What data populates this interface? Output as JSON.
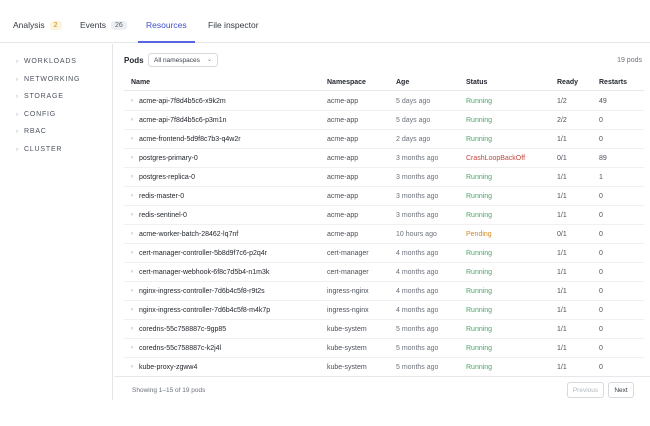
{
  "tabs": [
    {
      "label": "Analysis",
      "badge": "2"
    },
    {
      "label": "Events",
      "badge": "26"
    },
    {
      "label": "Resources",
      "badge": ""
    },
    {
      "label": "File inspector",
      "badge": ""
    }
  ],
  "active_tab": "Resources",
  "sidebar": {
    "items": [
      {
        "label": "WORKLOADS"
      },
      {
        "label": "NETWORKING"
      },
      {
        "label": "STORAGE"
      },
      {
        "label": "CONFIG"
      },
      {
        "label": "RBAC"
      },
      {
        "label": "CLUSTER"
      }
    ]
  },
  "pods": {
    "title": "Pods",
    "namespace_filter": "All namespaces",
    "count_label": "19 pods",
    "columns": {
      "name": "Name",
      "namespace": "Namespace",
      "age": "Age",
      "status": "Status",
      "ready": "Ready",
      "restarts": "Restarts"
    },
    "rows": [
      {
        "name": "acme-api-7f8d4b5c6-x9k2m",
        "namespace": "acme-app",
        "age": "5 days ago",
        "status": "Running",
        "ready": "1/2",
        "restarts": "49"
      },
      {
        "name": "acme-api-7f8d4b5c6-p3m1n",
        "namespace": "acme-app",
        "age": "5 days ago",
        "status": "Running",
        "ready": "2/2",
        "restarts": "0"
      },
      {
        "name": "acme-frontend-5d9f8c7b3-q4w2r",
        "namespace": "acme-app",
        "age": "2 days ago",
        "status": "Running",
        "ready": "1/1",
        "restarts": "0"
      },
      {
        "name": "postgres-primary-0",
        "namespace": "acme-app",
        "age": "3 months ago",
        "status": "CrashLoopBackOff",
        "ready": "0/1",
        "restarts": "89"
      },
      {
        "name": "postgres-replica-0",
        "namespace": "acme-app",
        "age": "3 months ago",
        "status": "Running",
        "ready": "1/1",
        "restarts": "1"
      },
      {
        "name": "redis-master-0",
        "namespace": "acme-app",
        "age": "3 months ago",
        "status": "Running",
        "ready": "1/1",
        "restarts": "0"
      },
      {
        "name": "redis-sentinel-0",
        "namespace": "acme-app",
        "age": "3 months ago",
        "status": "Running",
        "ready": "1/1",
        "restarts": "0"
      },
      {
        "name": "acme-worker-batch-28462-lq7nf",
        "namespace": "acme-app",
        "age": "10 hours ago",
        "status": "Pending",
        "ready": "0/1",
        "restarts": "0"
      },
      {
        "name": "cert-manager-controller-5b8d9f7c6-p2q4r",
        "namespace": "cert-manager",
        "age": "4 months ago",
        "status": "Running",
        "ready": "1/1",
        "restarts": "0"
      },
      {
        "name": "cert-manager-webhook-6f8c7d5b4-n1m3k",
        "namespace": "cert-manager",
        "age": "4 months ago",
        "status": "Running",
        "ready": "1/1",
        "restarts": "0"
      },
      {
        "name": "nginx-ingress-controller-7d6b4c5f8-r9t2s",
        "namespace": "ingress-nginx",
        "age": "4 months ago",
        "status": "Running",
        "ready": "1/1",
        "restarts": "0"
      },
      {
        "name": "nginx-ingress-controller-7d6b4c5f8-m4k7p",
        "namespace": "ingress-nginx",
        "age": "4 months ago",
        "status": "Running",
        "ready": "1/1",
        "restarts": "0"
      },
      {
        "name": "coredns-55c758887c-9gp85",
        "namespace": "kube-system",
        "age": "5 months ago",
        "status": "Running",
        "ready": "1/1",
        "restarts": "0"
      },
      {
        "name": "coredns-55c758887c-k2j4l",
        "namespace": "kube-system",
        "age": "5 months ago",
        "status": "Running",
        "ready": "1/1",
        "restarts": "0"
      },
      {
        "name": "kube-proxy-zgww4",
        "namespace": "kube-system",
        "age": "5 months ago",
        "status": "Running",
        "ready": "1/1",
        "restarts": "0"
      }
    ],
    "showing": "Showing 1–15 of 19 pods",
    "prev_label": "Previous",
    "next_label": "Next"
  },
  "colors": {
    "accent": "#5566e0",
    "running": "#4da36a",
    "crash": "#c2473e",
    "pending": "#d08a1f"
  }
}
